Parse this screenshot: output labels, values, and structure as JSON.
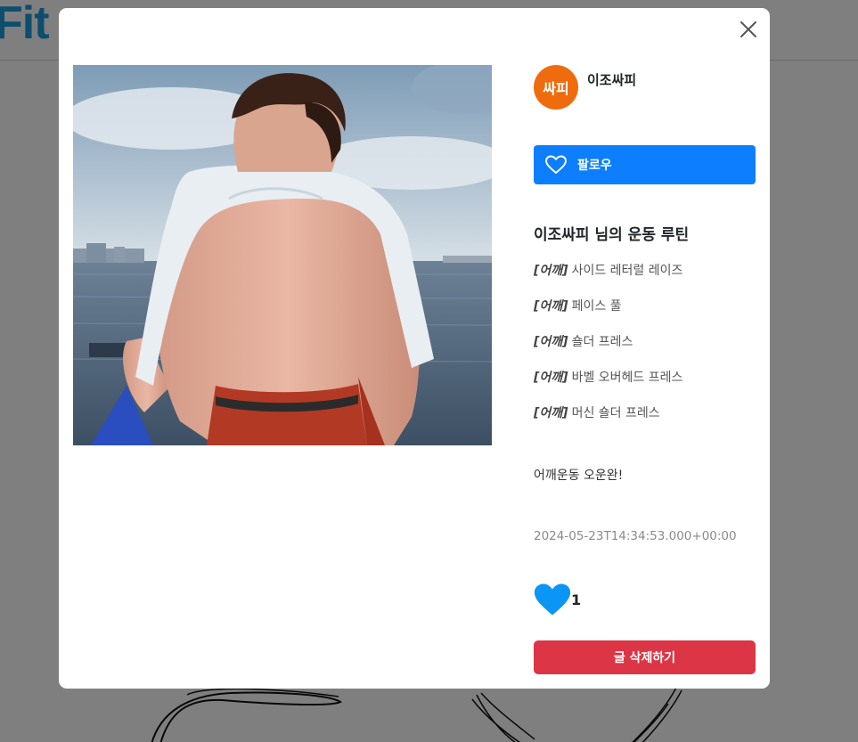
{
  "background": {
    "logo_text": "Fit"
  },
  "modal": {
    "close_icon": "close-icon",
    "photo_alt": "shoulder workout photo",
    "author": {
      "avatar_text": "싸피",
      "avatar_color": "#ee6c0e",
      "name": "이조싸피"
    },
    "follow_button": {
      "icon": "heart-outline-icon",
      "label": "팔로우",
      "color": "#0d7efd"
    },
    "routine": {
      "title": "이조싸피 님의 운동 루틴",
      "items": [
        {
          "category": "[어깨]",
          "exercise": "사이드 레터럴 레이즈"
        },
        {
          "category": "[어깨]",
          "exercise": "페이스 풀"
        },
        {
          "category": "[어깨]",
          "exercise": "숄더 프레스"
        },
        {
          "category": "[어깨]",
          "exercise": "바벨 오버헤드 프레스"
        },
        {
          "category": "[어깨]",
          "exercise": "머신 숄더 프레스"
        }
      ]
    },
    "content": "어깨운동 오운완!",
    "timestamp": "2024-05-23T14:34:53.000+00:00",
    "likes": {
      "icon": "heart-filled-icon",
      "count": "1",
      "color": "#0b96f5"
    },
    "delete_button": {
      "label": "글 삭제하기",
      "color": "#dc3545"
    }
  }
}
